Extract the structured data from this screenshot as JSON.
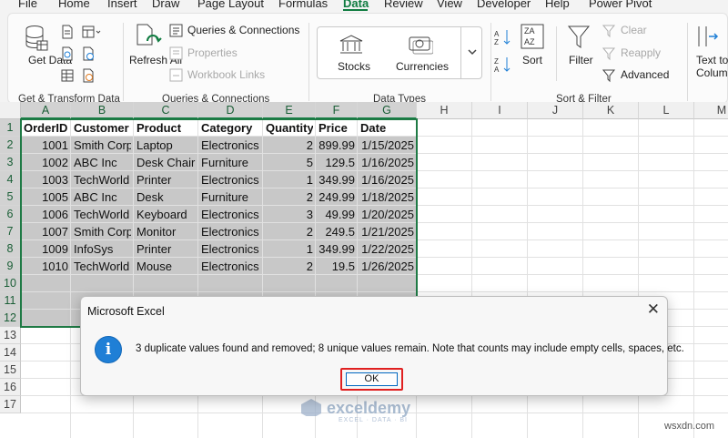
{
  "tabs": [
    "File",
    "Home",
    "Insert",
    "Draw",
    "Page Layout",
    "Formulas",
    "Data",
    "Review",
    "View",
    "Developer",
    "Help",
    "Power Pivot"
  ],
  "active_tab": "Data",
  "ribbon": {
    "get_data": "Get Data",
    "get_transform_label": "Get & Transform Data",
    "refresh_all": "Refresh All",
    "queries_connections": "Queries & Connections",
    "properties": "Properties",
    "workbook_links": "Workbook Links",
    "queries_group_label": "Queries & Connections",
    "stocks": "Stocks",
    "currencies": "Currencies",
    "data_types_label": "Data Types",
    "sort": "Sort",
    "filter": "Filter",
    "clear": "Clear",
    "reapply": "Reapply",
    "advanced": "Advanced",
    "sort_filter_label": "Sort & Filter",
    "text_to_columns": "Text to Columns"
  },
  "sheet": {
    "columns": [
      "A",
      "B",
      "C",
      "D",
      "E",
      "F",
      "G",
      "H",
      "I",
      "J",
      "K",
      "L",
      "M"
    ],
    "rows": [
      "1",
      "2",
      "3",
      "4",
      "5",
      "6",
      "7",
      "8",
      "9",
      "10",
      "11",
      "12",
      "13",
      "14",
      "15",
      "16",
      "17"
    ],
    "header": [
      "OrderID",
      "Customer",
      "Product",
      "Category",
      "Quantity",
      "Price",
      "Date"
    ],
    "data": [
      [
        "1001",
        "Smith Corp",
        "Laptop",
        "Electronics",
        "2",
        "899.99",
        "1/15/2025"
      ],
      [
        "1002",
        "ABC Inc",
        "Desk Chair",
        "Furniture",
        "5",
        "129.5",
        "1/16/2025"
      ],
      [
        "1003",
        "TechWorld",
        "Printer",
        "Electronics",
        "1",
        "349.99",
        "1/16/2025"
      ],
      [
        "1005",
        "ABC Inc",
        "Desk",
        "Furniture",
        "2",
        "249.99",
        "1/18/2025"
      ],
      [
        "1006",
        "TechWorld",
        "Keyboard",
        "Electronics",
        "3",
        "49.99",
        "1/20/2025"
      ],
      [
        "1007",
        "Smith Corp",
        "Monitor",
        "Electronics",
        "2",
        "249.5",
        "1/21/2025"
      ],
      [
        "1009",
        "InfoSys",
        "Printer",
        "Electronics",
        "1",
        "349.99",
        "1/22/2025"
      ],
      [
        "1010",
        "TechWorld",
        "Mouse",
        "Electronics",
        "2",
        "19.5",
        "1/26/2025"
      ]
    ]
  },
  "dialog": {
    "title": "Microsoft Excel",
    "message": "3 duplicate values found and removed; 8 unique values remain. Note that counts may include empty cells, spaces, etc.",
    "ok": "OK",
    "close": "✕"
  },
  "watermark": {
    "brand": "exceldemy",
    "tagline": "EXCEL · DATA · BI"
  },
  "corner_mark": "wsxdn.com",
  "colors": {
    "accent": "#107c41",
    "highlight": "#e02020",
    "info": "#1f7fd6"
  }
}
